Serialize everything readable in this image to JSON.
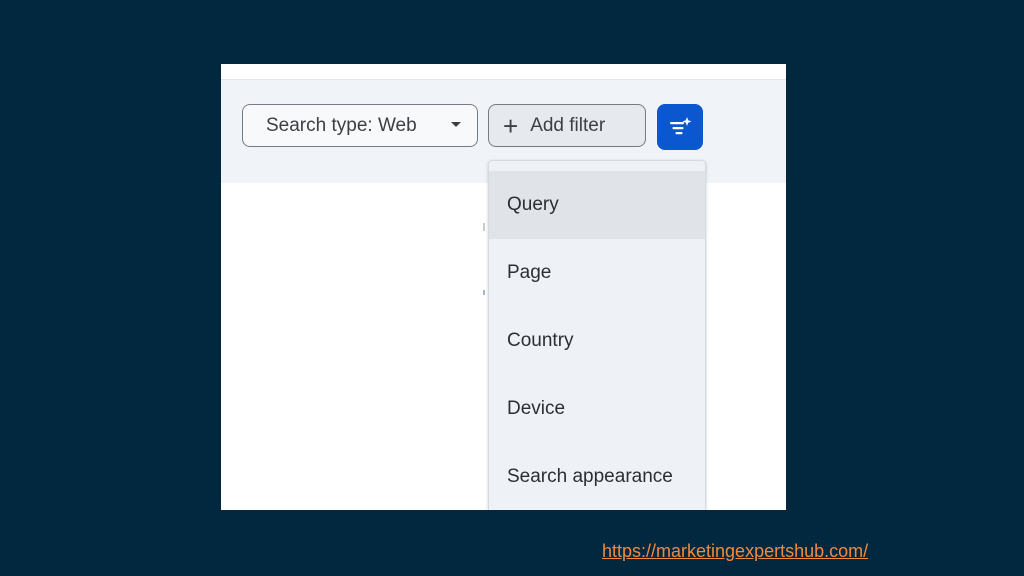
{
  "toolbar": {
    "search_type_label": "Search type: Web",
    "add_filter_label": "Add filter",
    "add_filter_icon": "plus-icon",
    "search_type_icon": "caret-down-icon",
    "filter_ai_icon": "filter-sparkle-icon"
  },
  "menu": {
    "items": [
      {
        "label": "Query",
        "active": true
      },
      {
        "label": "Page",
        "active": false
      },
      {
        "label": "Country",
        "active": false
      },
      {
        "label": "Device",
        "active": false
      },
      {
        "label": "Search appearance",
        "active": false
      }
    ]
  },
  "footer": {
    "url": "https://marketingexpertshub.com/"
  },
  "colors": {
    "slide_background": "#022840",
    "primary_button": "#0b57d0",
    "link": "#f28a3c"
  }
}
